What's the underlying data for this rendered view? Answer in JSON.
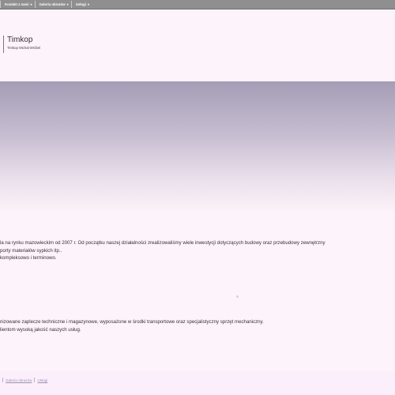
{
  "nav": {
    "items": [
      {
        "label": "Kontakt z nami"
      },
      {
        "label": "Galeria obrazów"
      },
      {
        "label": "Usługi"
      }
    ],
    "caret": "▾"
  },
  "header": {
    "title": "Timkop",
    "subtitle": "Timkop Michał Wróbel"
  },
  "content": {
    "paragraph1": [
      "la na rynku mazowieckim od 2007 r. Od początku naszej działalności zrealizowaliśmy wiele inwestycji dotyczących budowy oraz przebudowy zewnętrzny",
      "porty materiałów sypkich itp..",
      "kompleksowo i terminowo."
    ],
    "paragraph2": [
      "nizowane zaplecze techniczne i magazynowe, wyposażone w środki transportowe oraz specjalistyczny sprzęt mechaniczny.",
      "lientom wysoką jakość naszych usług."
    ]
  },
  "footer": {
    "links": [
      {
        "label": "Galeria obrazów"
      },
      {
        "label": "Usługi"
      }
    ]
  }
}
